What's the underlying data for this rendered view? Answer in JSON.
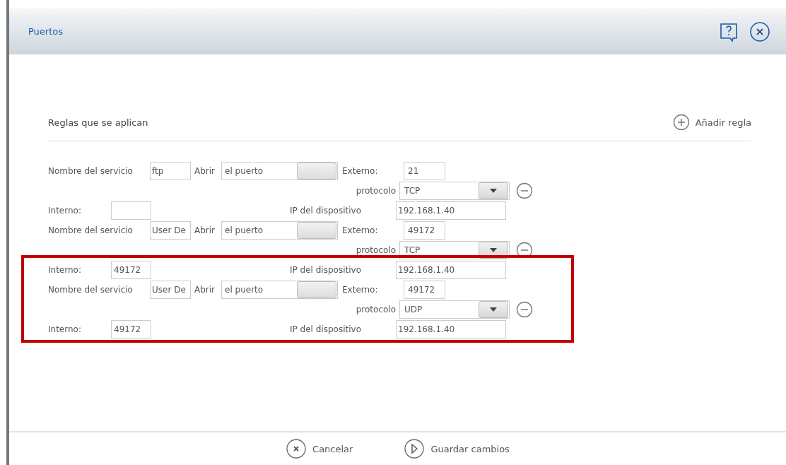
{
  "window": {
    "title": "Puertos"
  },
  "section": {
    "title": "Reglas que se aplican",
    "add_button": "Añadir regla"
  },
  "rules": [
    {
      "service_label": "Nombre del servicio",
      "service": "ftp",
      "open_label": "Abrir",
      "open": "el puerto",
      "external_label": "Externo:",
      "external": "21",
      "protocol_label": "protocolo",
      "protocol": "TCP",
      "internal_label": "Interno:",
      "ip_label": "IP del dispositivo",
      "ip": "192.168.1.40"
    },
    {
      "service_label": "Nombre del servicio",
      "service": "User De",
      "open_label": "Abrir",
      "open": "el puerto",
      "external_label": "Externo:",
      "external": "49172",
      "protocol_label": "protocolo",
      "protocol": "TCP",
      "internal_label": "Interno:",
      "internal": "49172",
      "ip_label": "IP del dispositivo",
      "ip": "192.168.1.40"
    },
    {
      "service_label": "Nombre del servicio",
      "service": "User De",
      "open_label": "Abrir",
      "open": "el puerto",
      "external_label": "Externo:",
      "external": "49172",
      "protocol_label": "protocolo",
      "protocol": "UDP",
      "internal_label": "Interno:",
      "internal": "49172",
      "ip_label": "IP del dispositivo",
      "ip": "192.168.1.40"
    }
  ],
  "annotation": {
    "kind": "rectangle"
  },
  "footer": {
    "buttons": [
      {
        "kind": "cancel",
        "label": "Cancelar"
      },
      {
        "kind": "save",
        "label": "Guardar cambios"
      }
    ]
  }
}
